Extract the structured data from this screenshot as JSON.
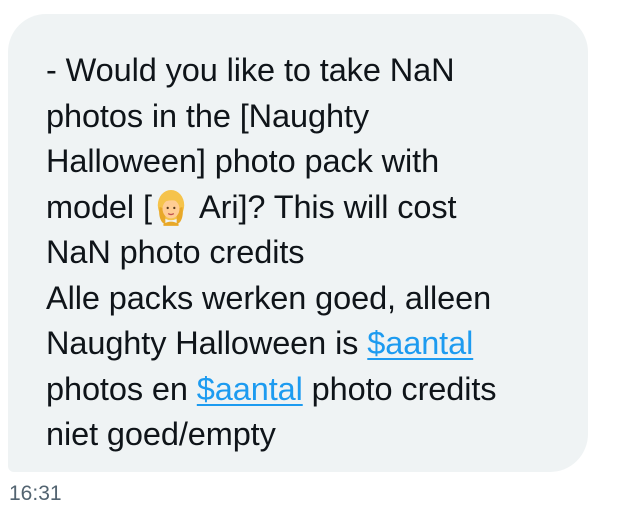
{
  "message": {
    "line1": "- Would you like to take NaN",
    "line2": "photos in the [Naughty",
    "line3": "Halloween] photo pack with",
    "line4_pre": "model [",
    "line4_post": " Ari]? This will cost",
    "line5": "NaN photo credits",
    "line6": "Alle packs werken goed, alleen",
    "line7_pre": "Naughty Halloween is ",
    "cashtag1": "$aantal",
    "line8_pre": "photos en ",
    "cashtag2": "$aantal",
    "line8_post": " photo credits",
    "line9": "niet goed/empty",
    "emoji_icon": "woman-blond-hair-emoji-icon"
  },
  "timestamp": "16:31",
  "colors": {
    "bubble_bg": "#eff3f4",
    "text": "#0f1419",
    "link": "#1d9bf0",
    "timestamp": "#536471"
  }
}
